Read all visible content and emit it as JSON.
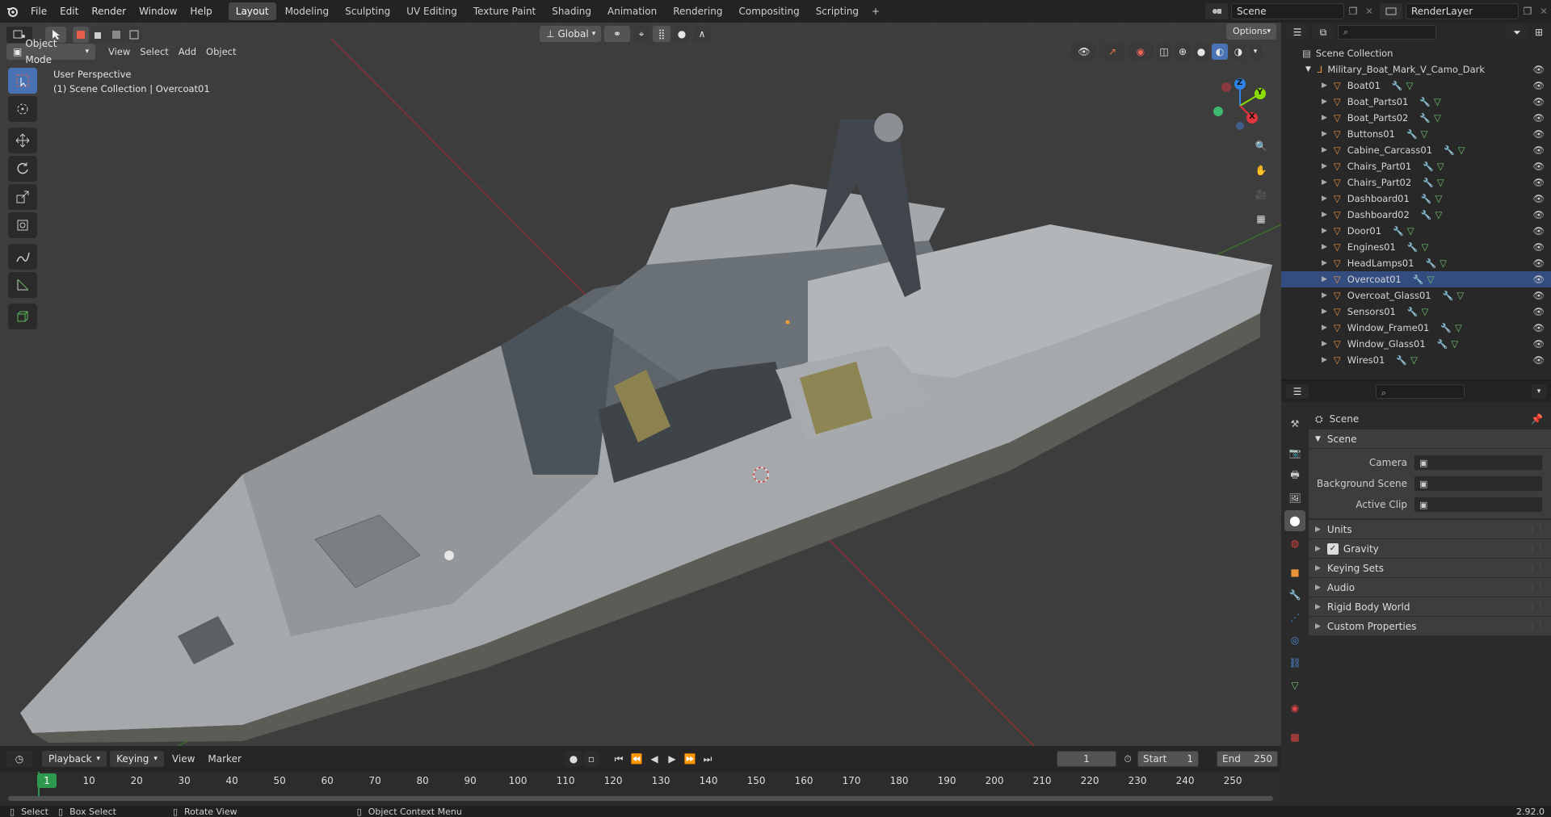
{
  "menus": [
    "File",
    "Edit",
    "Render",
    "Window",
    "Help"
  ],
  "workspaces": [
    {
      "label": "Layout",
      "active": true
    },
    {
      "label": "Modeling",
      "active": false
    },
    {
      "label": "Sculpting",
      "active": false
    },
    {
      "label": "UV Editing",
      "active": false
    },
    {
      "label": "Texture Paint",
      "active": false
    },
    {
      "label": "Shading",
      "active": false
    },
    {
      "label": "Animation",
      "active": false
    },
    {
      "label": "Rendering",
      "active": false
    },
    {
      "label": "Compositing",
      "active": false
    },
    {
      "label": "Scripting",
      "active": false
    }
  ],
  "topright": {
    "scene": "Scene",
    "view_layer": "RenderLayer"
  },
  "viewport": {
    "mode": "Object Mode",
    "menus": [
      "View",
      "Select",
      "Add",
      "Object"
    ],
    "transform_orientation": "Global",
    "options": "Options",
    "overlay_line1": "User Perspective",
    "overlay_line2": "(1) Scene Collection | Overcoat01",
    "gizmo_axes": {
      "x": "X",
      "y": "Y",
      "z": "Z"
    }
  },
  "outliner": {
    "root": "Scene Collection",
    "collection": "Military_Boat_Mark_V_Camo_Dark",
    "objects": [
      "Boat01",
      "Boat_Parts01",
      "Boat_Parts02",
      "Buttons01",
      "Cabine_Carcass01",
      "Chairs_Part01",
      "Chairs_Part02",
      "Dashboard01",
      "Dashboard02",
      "Door01",
      "Engines01",
      "HeadLamps01",
      "Overcoat01",
      "Overcoat_Glass01",
      "Sensors01",
      "Window_Frame01",
      "Window_Glass01",
      "Wires01"
    ],
    "selected": "Overcoat01"
  },
  "properties": {
    "context": "Scene",
    "panel": "Scene",
    "fields": [
      {
        "label": "Camera"
      },
      {
        "label": "Background Scene"
      },
      {
        "label": "Active Clip"
      }
    ],
    "sections": [
      {
        "label": "Units",
        "checkbox": false
      },
      {
        "label": "Gravity",
        "checkbox": true
      },
      {
        "label": "Keying Sets",
        "checkbox": false
      },
      {
        "label": "Audio",
        "checkbox": false
      },
      {
        "label": "Rigid Body World",
        "checkbox": false
      },
      {
        "label": "Custom Properties",
        "checkbox": false
      }
    ]
  },
  "timeline": {
    "menus": [
      "Playback",
      "Keying",
      "View",
      "Marker"
    ],
    "current_frame": "1",
    "start_label": "Start",
    "start": "1",
    "end_label": "End",
    "end": "250",
    "ticks": [
      "10",
      "20",
      "30",
      "40",
      "50",
      "60",
      "70",
      "80",
      "90",
      "100",
      "110",
      "120",
      "130",
      "140",
      "150",
      "160",
      "170",
      "180",
      "190",
      "200",
      "210",
      "220",
      "230",
      "240",
      "250"
    ],
    "playhead": "1"
  },
  "status": {
    "select": "Select",
    "box_select": "Box Select",
    "rotate_view": "Rotate View",
    "context_menu": "Object Context Menu",
    "version": "2.92.0"
  },
  "colors": {
    "accent": "#4772b3",
    "object": "#e8923a",
    "mesh": "#6fc56f",
    "x_axis": "#e0343f",
    "y_axis": "#8bdc00",
    "z_axis": "#2e84e6",
    "playhead": "#2f9a4f"
  }
}
